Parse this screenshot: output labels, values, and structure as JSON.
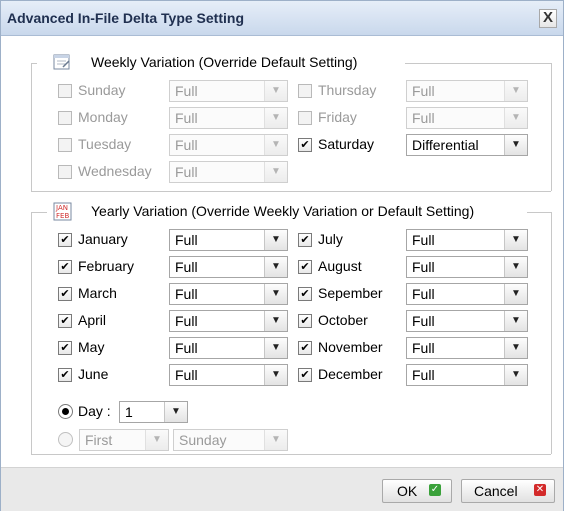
{
  "dialog": {
    "title": "Advanced In-File Delta Type Setting",
    "close_label": "X"
  },
  "weekly": {
    "title": "Weekly Variation (Override Default Setting)",
    "icon": "calendar-week-icon",
    "days": [
      {
        "label": "Sunday",
        "checked": false,
        "value": "Full"
      },
      {
        "label": "Monday",
        "checked": false,
        "value": "Full"
      },
      {
        "label": "Tuesday",
        "checked": false,
        "value": "Full"
      },
      {
        "label": "Wednesday",
        "checked": false,
        "value": "Full"
      },
      {
        "label": "Thursday",
        "checked": false,
        "value": "Full"
      },
      {
        "label": "Friday",
        "checked": false,
        "value": "Full"
      },
      {
        "label": "Saturday",
        "checked": true,
        "value": "Differential"
      }
    ]
  },
  "yearly": {
    "title": "Yearly Variation (Override Weekly Variation or Default Setting)",
    "icon": "calendar-month-icon",
    "icon_text": "JAN FEB",
    "months": [
      {
        "label": "January",
        "checked": true,
        "value": "Full"
      },
      {
        "label": "February",
        "checked": true,
        "value": "Full"
      },
      {
        "label": "March",
        "checked": true,
        "value": "Full"
      },
      {
        "label": "April",
        "checked": true,
        "value": "Full"
      },
      {
        "label": "May",
        "checked": true,
        "value": "Full"
      },
      {
        "label": "June",
        "checked": true,
        "value": "Full"
      },
      {
        "label": "July",
        "checked": true,
        "value": "Full"
      },
      {
        "label": "August",
        "checked": true,
        "value": "Full"
      },
      {
        "label": "Sepember",
        "checked": true,
        "value": "Full"
      },
      {
        "label": "October",
        "checked": true,
        "value": "Full"
      },
      {
        "label": "November",
        "checked": true,
        "value": "Full"
      },
      {
        "label": "December",
        "checked": true,
        "value": "Full"
      }
    ],
    "day_option": {
      "label": "Day :",
      "value": "1",
      "selected": true
    },
    "weekday_option": {
      "ordinal": "First",
      "weekday": "Sunday",
      "selected": false
    }
  },
  "footer": {
    "ok_label": "OK",
    "cancel_label": "Cancel"
  },
  "colors": {
    "titlebar": "#c9d8ec",
    "ok_icon": "#3aa13a",
    "cancel_icon": "#d32a2a"
  }
}
